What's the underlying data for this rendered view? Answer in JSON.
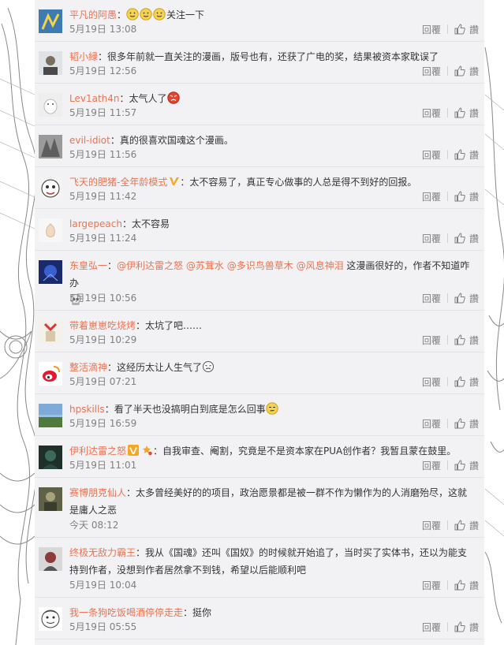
{
  "comments": [
    {
      "user": "平凡的阿愚",
      "text": "关注一下",
      "time": "5月19日 13:08",
      "reply": "回覆",
      "like": "讚",
      "height": 53
    },
    {
      "user": "韬小緑",
      "text": "很多年前就一直关注的漫画，版号也有，还获了广电的奖，结果被资本家耽误了",
      "time": "5月19日 12:56",
      "reply": "回覆",
      "like": "讚",
      "height": 53
    },
    {
      "user": "Lev1ath4n",
      "text": "太气人了",
      "time": "5月19日 11:57",
      "reply": "回覆",
      "like": "讚",
      "height": 53
    },
    {
      "user": "evil-idiot",
      "text": "真的很喜欢国魂这个漫画。",
      "time": "5月19日 11:56",
      "reply": "回覆",
      "like": "讚",
      "height": 53
    },
    {
      "user": "飞天的肥猪-全年龄模式",
      "text": "太不容易了，真正专心做事的人总是得不到好的回报。",
      "time": "5月19日 11:42",
      "reply": "回覆",
      "like": "讚",
      "height": 53
    },
    {
      "user": "largepeach",
      "text": "太不容易",
      "time": "5月19日 11:24",
      "reply": "回覆",
      "like": "讚",
      "height": 53
    },
    {
      "user": "东皇弘一",
      "mentions": [
        "@伊利达雷之怒",
        "@苏茸水",
        "@多识鸟兽草木",
        "@风息神泪"
      ],
      "text": "这漫画很好的，作者不知道咋办",
      "time": "5月19日 10:56",
      "reply": "回覆",
      "like": "讚",
      "height": 76
    },
    {
      "user": "带着崽崽吃烧烤",
      "text": "太坑了吧……",
      "time": "5月19日 10:29",
      "reply": "回覆",
      "like": "讚",
      "height": 53
    },
    {
      "user": "整活滴神",
      "text": "这经历太让人生气了",
      "time": "5月19日 07:21",
      "reply": "回覆",
      "like": "讚",
      "height": 53
    },
    {
      "user": "hpskills",
      "text": "看了半天也没搞明白到底是怎么回事",
      "time": "5月19日 16:59",
      "reply": "回覆",
      "like": "讚",
      "height": 53
    },
    {
      "user": "伊利达雷之怒",
      "text": "自我审查、阉割，究竟是不是资本家在PUA创作者？我暂且蒙在鼓里。",
      "time": "5月19日 11:01",
      "reply": "回覆",
      "like": "讚",
      "height": 53
    },
    {
      "user": "赛博朋克仙人",
      "text": "太多曾经美好的的项目，政治愿景都是被一群不作为懒作为的人消磨殆尽，这就是庸人之恶",
      "time": "今天 08:12",
      "reply": "回覆",
      "like": "讚",
      "height": 76
    },
    {
      "user": "终极无敌力霸王",
      "text": "我从《国魂》还叫《国奴》的时候就开始追了，当时买了实体书，还以为能支持到作者，没想到作者居然拿不到钱，希望以后能顺利吧",
      "time": "5月19日 10:04",
      "reply": "回覆",
      "like": "讚",
      "height": 76
    },
    {
      "user": "我一条狗吃饭喝酒停停走走",
      "text": "挺你",
      "time": "5月19日 05:55",
      "reply": "回覆",
      "like": "讚",
      "height": 53
    }
  ],
  "colors": {
    "username": "#eb7350",
    "meta": "#808080",
    "panel_bg": "#f2f2f5"
  }
}
